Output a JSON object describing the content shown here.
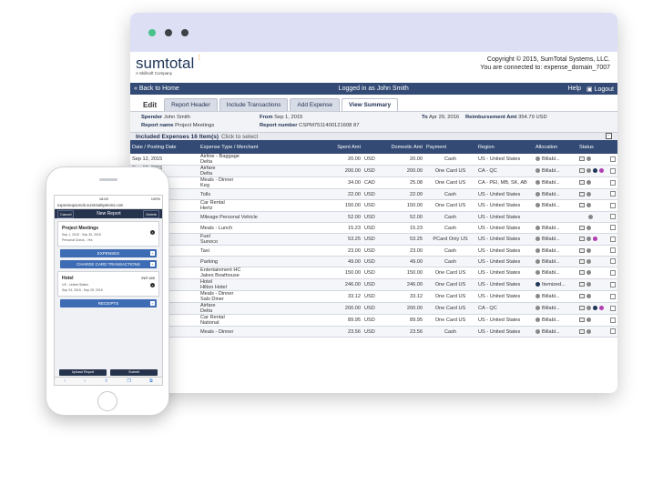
{
  "app": {
    "logo": "sumtotal",
    "logo_tag": "A Skillsoft Company",
    "copyright": "Copyright © 2015, SumTotal Systems, LLC.",
    "connected": "You are connected to: expense_domain_7007"
  },
  "nav": {
    "back": "« Back to Home",
    "logged_in": "Logged in as John Smith",
    "help": "Help",
    "logout": "Logout"
  },
  "tabs": [
    "Edit",
    "Report Header",
    "Include Transactions",
    "Add Expense",
    "View Summary"
  ],
  "info": {
    "spender_label": "Spender",
    "spender": "John Smith",
    "report_name_label": "Report name",
    "report_name": "Project Meetings",
    "from_label": "From",
    "from": "Sep 1, 2015",
    "report_number_label": "Report number",
    "report_number": "CSPM7511400121608 87",
    "to_label": "To",
    "to": "Apr 29, 2016",
    "reimb_label": "Reimbursement Amt",
    "reimb": "354.79 USD"
  },
  "items_header": {
    "title": "Included Expenses 16 Item(s)",
    "hint": "Click to select"
  },
  "columns": [
    "Date / Posting Date",
    "Expense Type / Merchant",
    "Spent Amt",
    "",
    "Domestic Amt",
    "Payment",
    "Region",
    "Allocation",
    "Status",
    ""
  ],
  "rows": [
    {
      "date": "Sep 12, 2015",
      "type": "Airline - Baggage",
      "merchant": "Delta",
      "spent": "20.00",
      "cur": "USD",
      "dom": "20.00",
      "pay": "Cash",
      "region": "US - United States",
      "alloc": "Billabl...",
      "status": "i"
    },
    {
      "date": "Sep 12, 2015",
      "date2": "Sep 12, 2015",
      "type": "Airfare",
      "merchant": "Delta",
      "spent": "200.00",
      "cur": "USD",
      "dom": "200.00",
      "pay": "One Card US",
      "region": "CA - QC",
      "alloc": "Billabl...",
      "status": "ip"
    },
    {
      "date": "Sep 13, 2015",
      "type": "Meals - Dinner",
      "merchant": "Keg",
      "spent": "34.00",
      "cur": "CAD",
      "dom": "25.08",
      "pay": "One Card US",
      "region": "CA - PEI, MB, SK, AB",
      "alloc": "Billabl...",
      "status": "i"
    },
    {
      "date": "ep 14, 2015",
      "type": "Tolls",
      "merchant": "",
      "spent": "22.00",
      "cur": "USD",
      "dom": "22.00",
      "pay": "Cash",
      "region": "US - United States",
      "alloc": "Billabl...",
      "status": "i"
    },
    {
      "date": "ep 14, 2015",
      "date2": "ep 13, 2015",
      "type": "Car Rental",
      "merchant": "Hertz",
      "spent": "150.00",
      "cur": "USD",
      "dom": "150.00",
      "pay": "One Card US",
      "region": "US - United States",
      "alloc": "Billabl...",
      "status": "i"
    },
    {
      "date": "Sep 16, 2015",
      "type": "Mileage Personal Vehicle",
      "merchant": "",
      "spent": "52.00",
      "cur": "USD",
      "dom": "52.00",
      "pay": "Cash",
      "region": "US - United States",
      "alloc": "",
      "status": "g"
    },
    {
      "date": "Sep 16, 2015",
      "type": "Meals - Lunch",
      "merchant": "",
      "spent": "15.23",
      "cur": "USD",
      "dom": "15.23",
      "pay": "Cash",
      "region": "US - United States",
      "alloc": "Billabl...",
      "status": "i"
    },
    {
      "date": "ep 18, 2015",
      "date2": "ep 18, 2015",
      "type": "Fuel",
      "merchant": "Sunoco",
      "spent": "53.25",
      "cur": "USD",
      "dom": "53.25",
      "pay": "PCard Only US",
      "region": "US - United States",
      "alloc": "Billabl...",
      "status": "ipp"
    },
    {
      "date": "ep 24, 2015",
      "type": "Taxi",
      "merchant": "",
      "spent": "23.00",
      "cur": "USD",
      "dom": "23.00",
      "pay": "Cash",
      "region": "US - United States",
      "alloc": "Billabl...",
      "status": "i"
    },
    {
      "date": "ep 24, 2015",
      "type": "Parking",
      "merchant": "",
      "spent": "49.00",
      "cur": "USD",
      "dom": "49.00",
      "pay": "Cash",
      "region": "US - United States",
      "alloc": "Billabl...",
      "status": "i"
    },
    {
      "date": "ep 24, 2015",
      "date2": "ep 24, 2015",
      "type": "Entertainment HC",
      "merchant": "Jakes Boathouse",
      "spent": "150.00",
      "cur": "USD",
      "dom": "150.00",
      "pay": "One Card US",
      "region": "US - United States",
      "alloc": "Billabl...",
      "status": "i"
    },
    {
      "date": "ep 24, 2015",
      "date2": "ep 24, 2015",
      "type": "Hotel",
      "merchant": "Hilton Hotel",
      "spent": "246.00",
      "cur": "USD",
      "dom": "246.00",
      "pay": "One Card US",
      "region": "US - United States",
      "alloc": "Itemized...",
      "status": "i"
    },
    {
      "date": "ep 24, 2015",
      "date2": "ep 24, 2015",
      "type": "Meals - Dinner",
      "merchant": "Sals Diner",
      "spent": "33.12",
      "cur": "USD",
      "dom": "33.12",
      "pay": "One Card US",
      "region": "US - United States",
      "alloc": "Billabl...",
      "status": "i"
    },
    {
      "date": "Sep 24, 2015",
      "date2": "Sep 24, 2015",
      "type": "Airfare",
      "merchant": "Delta",
      "spent": "200.00",
      "cur": "USD",
      "dom": "200.00",
      "pay": "One Card US",
      "region": "CA - QC",
      "alloc": "Billabl...",
      "status": "ip"
    },
    {
      "date": "Sep 24, 2015",
      "date2": "Sep 24, 2015",
      "type": "Car Rental",
      "merchant": "National",
      "spent": "89.95",
      "cur": "USD",
      "dom": "89.95",
      "pay": "One Card US",
      "region": "US - United States",
      "alloc": "Billabl...",
      "status": "i"
    },
    {
      "date": "Sep 25, 2015",
      "type": "Meals - Dinner",
      "merchant": "",
      "spent": "23.56",
      "cur": "USD",
      "dom": "23.56",
      "pay": "Cash",
      "region": "US - United States",
      "alloc": "Billabl...",
      "status": "i"
    }
  ],
  "phone": {
    "time": "16:00",
    "carrier": "",
    "battery": "100%",
    "url": "expenseqa1mob.sumtotalsystems.com",
    "cancel": "Cancel",
    "title": "New Report",
    "delete": "Delete",
    "report_title": "Project Meetings",
    "report_dates": "Sep 1, 2015 - Sep 30, 2015",
    "report_check": "Personal Check - Yes",
    "expenses": "EXPENSES",
    "charge_card": "CHARGE CARD TRANSACTIONS",
    "hotel": "Hotel",
    "hotel_loc": "US - United States",
    "hotel_dates": "Sep 24, 2015 - Sep 25, 2015",
    "hotel_amt": "INR 485",
    "receipts": "RECEIPTS",
    "upload": "Upload Report",
    "submit": "Submit"
  }
}
